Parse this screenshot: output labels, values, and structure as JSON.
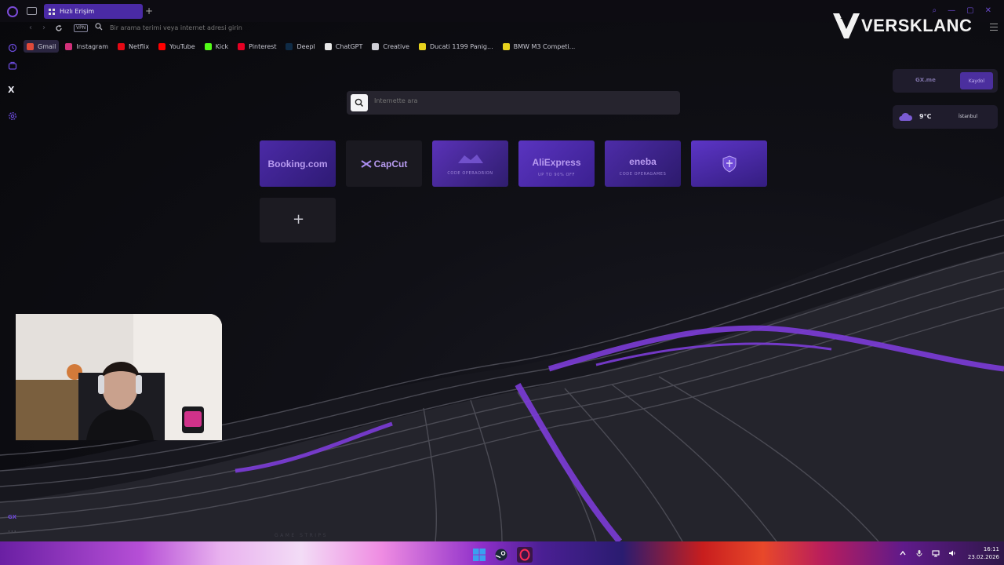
{
  "browser": {
    "tab": {
      "label": "Hızlı Erişim"
    },
    "address_placeholder": "Bir arama terimi veya internet adresi girin",
    "vpn_label": "VPN"
  },
  "bookmarks": [
    {
      "label": "Gmail",
      "icon": "gmail-icon",
      "color": "#e04a3a"
    },
    {
      "label": "Instagram",
      "icon": "instagram-icon",
      "color": "#d1307a"
    },
    {
      "label": "Netflix",
      "icon": "netflix-icon",
      "color": "#e50914"
    },
    {
      "label": "YouTube",
      "icon": "youtube-icon",
      "color": "#ff0000"
    },
    {
      "label": "Kick",
      "icon": "kick-icon",
      "color": "#53fc18"
    },
    {
      "label": "Pinterest",
      "icon": "pinterest-icon",
      "color": "#e60023"
    },
    {
      "label": "Deepl",
      "icon": "deepl-icon",
      "color": "#0f2b46"
    },
    {
      "label": "ChatGPT",
      "icon": "chatgpt-icon",
      "color": "#e8e8e8"
    },
    {
      "label": "Creative",
      "icon": "folder-icon",
      "color": "#cfcfd6"
    },
    {
      "label": "Ducati 1199 Panig...",
      "icon": "site-icon",
      "color": "#e7d21d"
    },
    {
      "label": "BMW M3 Competi...",
      "icon": "site-icon",
      "color": "#e7d21d"
    }
  ],
  "sidebar": {
    "x_label": "X",
    "gx_label": "GX",
    "more_label": "···"
  },
  "watermark": "VERSKLANC",
  "search": {
    "placeholder": "Internette ara"
  },
  "speed_dials": [
    {
      "title": "Booking.com",
      "sub": ""
    },
    {
      "title": "CapCut",
      "sub": ""
    },
    {
      "title": "",
      "sub": "CODE  OPERAORION"
    },
    {
      "title": "AliExpress",
      "sub": "UP TO  90% OFF"
    },
    {
      "title": "eneba",
      "sub": "CODE  OPERAGAMES"
    },
    {
      "title": "",
      "sub": ""
    }
  ],
  "widgets": {
    "gx_me": "GX.me",
    "gx_button": "Kaydol",
    "weather_temp": "9°C",
    "weather_city": "İstanbul"
  },
  "wallpaper_caption": "GAME STRIPS",
  "taskbar": {
    "time": "16:11",
    "date": "23.02.2026"
  },
  "colors": {
    "accent": "#5b34c4",
    "tab_active": "#4a2aa5",
    "dial_bg": "#3a1f86"
  }
}
